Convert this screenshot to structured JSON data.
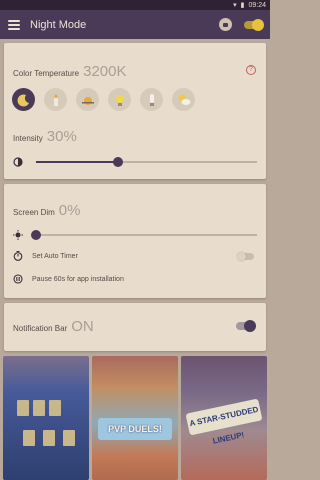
{
  "status_bar": {
    "time": "09:24"
  },
  "app_bar": {
    "title": "Night Mode"
  },
  "color_temperature": {
    "label": "Color Temperature",
    "value": "3200K",
    "presets": [
      {
        "name": "moon-icon"
      },
      {
        "name": "candle-icon"
      },
      {
        "name": "sunset-icon"
      },
      {
        "name": "bulb-icon"
      },
      {
        "name": "fluorescent-icon"
      },
      {
        "name": "daylight-cloud-icon"
      }
    ]
  },
  "intensity": {
    "label": "Intensity",
    "value": "30%",
    "level": 0.37
  },
  "screen_dim": {
    "label": "Screen Dim",
    "value": "0%",
    "level": 0.0
  },
  "options": {
    "auto_timer": "Set Auto Timer",
    "pause": "Pause 60s for app installation"
  },
  "notification_bar": {
    "label": "Notification Bar",
    "value": "ON"
  },
  "background_app": {
    "banner_pvp": "PVP DUELS!",
    "banner_star": "A STAR-STUDDED LINEUP!"
  },
  "colors": {
    "accent": "#4a3a58",
    "card": "#e8dccc",
    "help": "#c46060"
  }
}
